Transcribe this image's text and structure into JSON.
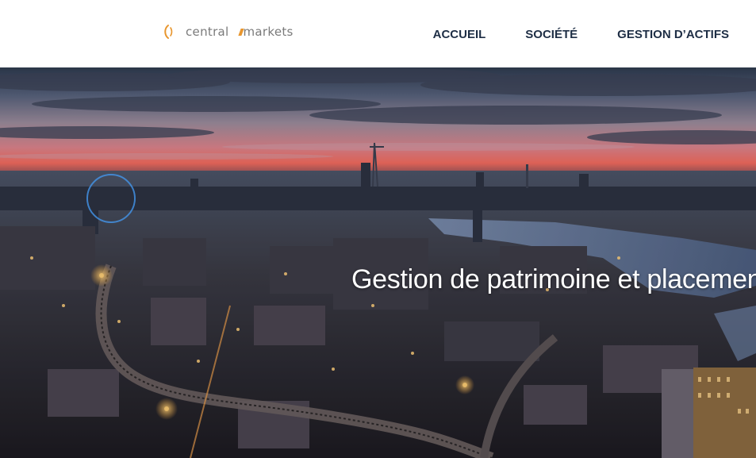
{
  "brand": {
    "name_part1": "central",
    "name_part2": "markets",
    "logo_icon": "central-markets-logo-mark",
    "accent_color": "#e8962e"
  },
  "nav": {
    "items": [
      {
        "label": "ACCUEIL"
      },
      {
        "label": "SOCIÉTÉ"
      },
      {
        "label": "GESTION D’ACTIFS"
      }
    ],
    "text_color": "#1e2e45"
  },
  "hero": {
    "title": "Gestion de patrimoine et placemen",
    "image": "london-skyline-at-dusk"
  }
}
